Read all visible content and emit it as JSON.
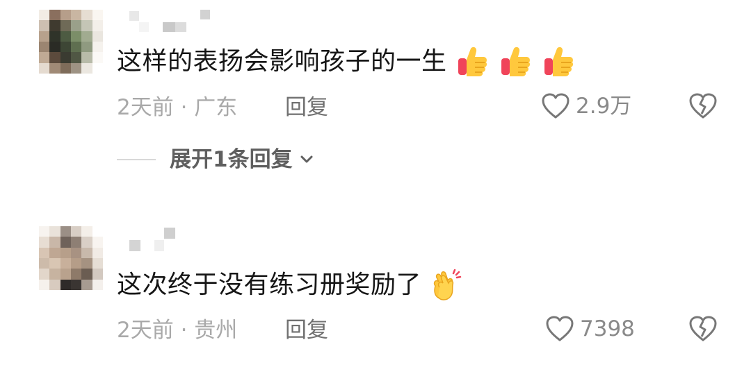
{
  "comments": [
    {
      "text": "这样的表扬会影响孩子的一生",
      "emojis": [
        "thumbs-up-icon",
        "thumbs-up-icon",
        "thumbs-up-icon"
      ],
      "meta": "2天前 · 广东",
      "reply_label": "回复",
      "likes": "2.9万",
      "expand_label": "展开1条回复"
    },
    {
      "text": "这次终于没有练习册奖励了",
      "emojis": [
        "clapping-hands-icon"
      ],
      "meta": "2天前 · 贵州",
      "reply_label": "回复",
      "likes": "7398"
    }
  ],
  "colors": {
    "text": "#161616",
    "meta": "#a9a9a9",
    "reply": "#707070",
    "expand": "#5f5f5f",
    "emoji_yellow": "#ffc83d",
    "emoji_red": "#f0445a"
  }
}
